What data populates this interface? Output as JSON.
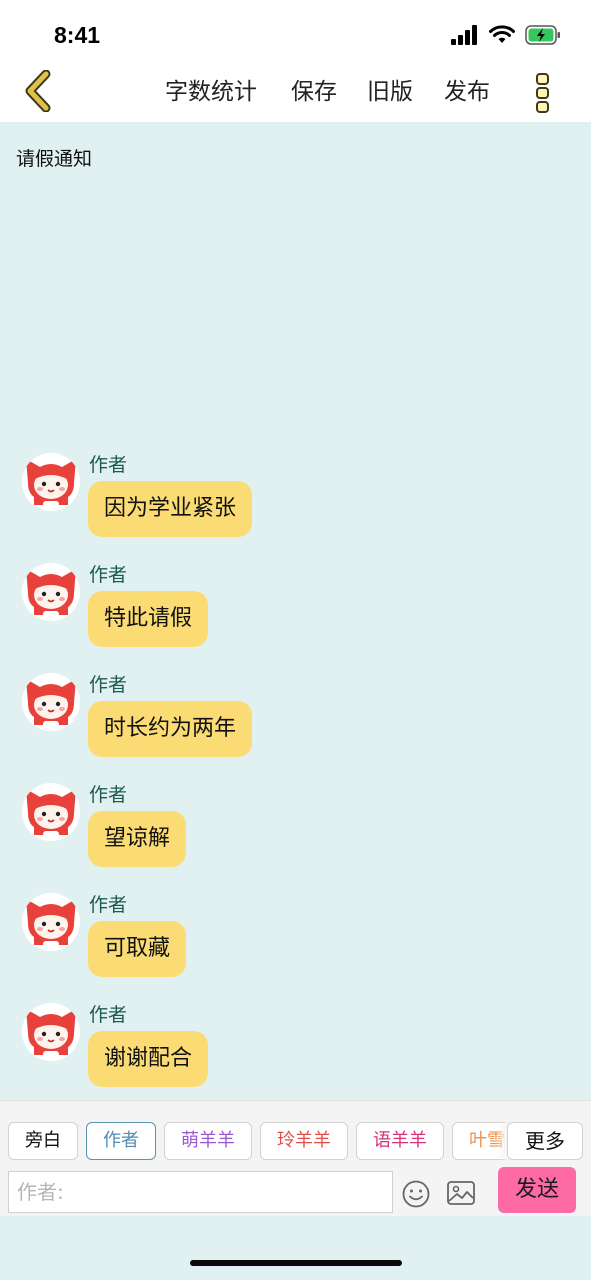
{
  "status_bar": {
    "time": "8:41"
  },
  "nav": {
    "actions": [
      "字数统计",
      "保存",
      "旧版",
      "发布"
    ]
  },
  "document": {
    "title": "请假通知"
  },
  "messages": [
    {
      "role": "作者",
      "text": "因为学业紧张"
    },
    {
      "role": "作者",
      "text": "特此请假"
    },
    {
      "role": "作者",
      "text": "时长约为两年"
    },
    {
      "role": "作者",
      "text": "望谅解"
    },
    {
      "role": "作者",
      "text": "可取藏"
    },
    {
      "role": "作者",
      "text": "谢谢配合"
    }
  ],
  "composer": {
    "roles": [
      {
        "label": "旁白",
        "color": "#111111",
        "selected": false
      },
      {
        "label": "作者",
        "color": "#4f8db2",
        "selected": true
      },
      {
        "label": "萌羊羊",
        "color": "#9b59d0",
        "selected": false
      },
      {
        "label": "玲羊羊",
        "color": "#e0504a",
        "selected": false
      },
      {
        "label": "语羊羊",
        "color": "#d9327c",
        "selected": false
      },
      {
        "label": "叶雪",
        "color": "#f08f4c",
        "selected": false
      }
    ],
    "more_label": "更多",
    "input_placeholder": "作者:",
    "send_label": "发送"
  },
  "colors": {
    "background": "#e1f1f1",
    "bubble": "#fbdb74",
    "role_name": "#1d5b50",
    "send_button": "#fd6aa4",
    "back_arrow": "#e3c04a",
    "battery_fill": "#35c759"
  }
}
